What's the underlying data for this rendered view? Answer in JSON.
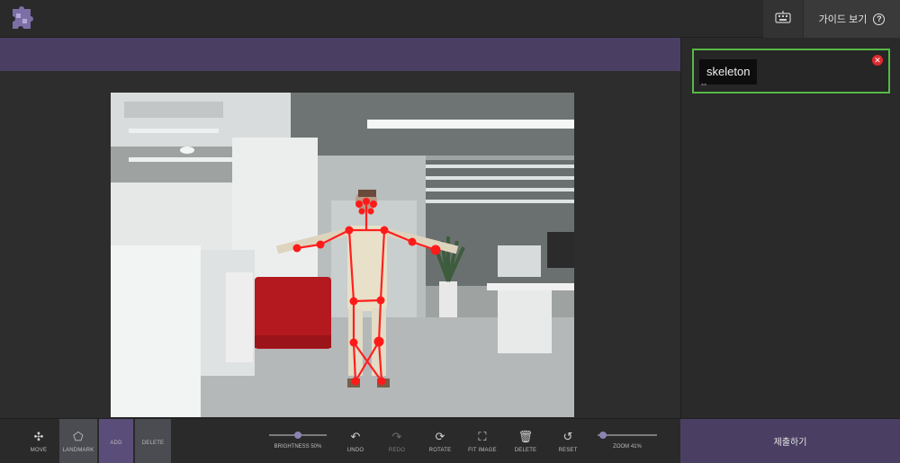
{
  "header": {
    "guide_label": "가이드 보기",
    "help_icon": "?"
  },
  "labels_panel": {
    "items": [
      {
        "name": "skeleton",
        "border_color": "#57b947"
      }
    ]
  },
  "toolbar": {
    "tools": [
      {
        "id": "move",
        "label": "MOVE",
        "icon": "move-arrows-icon",
        "glyph": "✣"
      },
      {
        "id": "landmark",
        "label": "LANDMARK",
        "icon": "landmark-pentagon-icon",
        "glyph": "⬠"
      },
      {
        "id": "add",
        "label": "ADD",
        "icon": "",
        "glyph": ""
      },
      {
        "id": "delete_mode",
        "label": "DELETE",
        "icon": "",
        "glyph": ""
      },
      {
        "id": "undo",
        "label": "UNDO",
        "icon": "undo-icon",
        "glyph": "↶"
      },
      {
        "id": "redo",
        "label": "REDO",
        "icon": "redo-icon",
        "glyph": "↷"
      },
      {
        "id": "rotate",
        "label": "ROTATE",
        "icon": "rotate-icon",
        "glyph": "⟳"
      },
      {
        "id": "fit",
        "label": "FIT IMAGE",
        "icon": "fit-image-icon",
        "glyph": "⛶"
      },
      {
        "id": "delete",
        "label": "DELETE",
        "icon": "trash-icon",
        "glyph": "🗑"
      },
      {
        "id": "reset",
        "label": "RESET",
        "icon": "reset-icon",
        "glyph": "↺"
      }
    ],
    "brightness": {
      "label": "BRIGHTNESS 50%",
      "value": 0.5
    },
    "zoom": {
      "label": "ZOOM 41%",
      "value": 0.41
    }
  },
  "submit": {
    "label": "제출하기"
  },
  "colors": {
    "accent_purple": "#4a3f63",
    "selected_tool": "#5a4d7a",
    "skeleton_red": "#ff1a1a",
    "label_green": "#57b947"
  }
}
